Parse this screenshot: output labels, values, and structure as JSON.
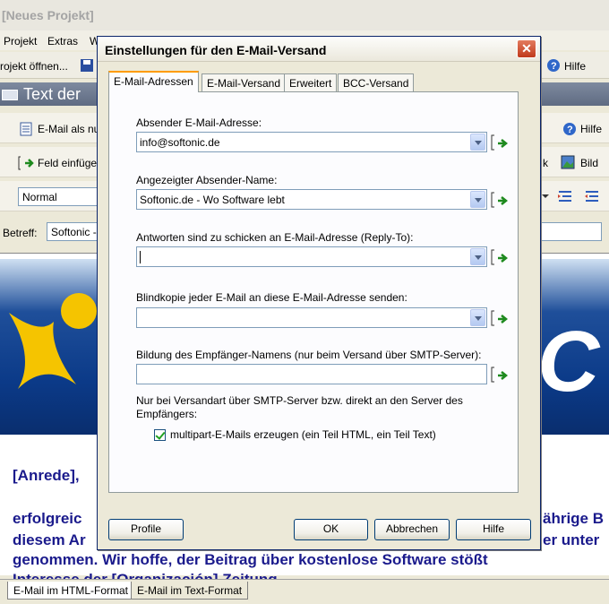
{
  "app": {
    "title": "[Neues Projekt]",
    "menu": [
      "Projekt",
      "Extras",
      "W"
    ],
    "toolbar1": {
      "open_label": "rojekt öffnen...",
      "help_label": "Hilfe"
    },
    "section_title": "Text der",
    "toolbar2": {
      "email_label": "E-Mail als nu",
      "help_label": "Hilfe"
    },
    "toolbar3": {
      "field_label": "Feld einfüge",
      "right_label": "k",
      "image_label": "Bild"
    },
    "toolbar4": {
      "style_value": "Normal"
    },
    "subject": {
      "label": "Betreff:",
      "value": "Softonic -"
    },
    "body_lines": [
      "[Anrede],",
      "erfolgreic",
      "diesem Ar",
      "genommen. Wir hoffe, der Beitrag über kostenlose Software stößt",
      "Interesse der [Organización] Zeitung."
    ],
    "body_right": [
      "ährige B",
      "er unter"
    ],
    "bottom_tabs": [
      "E-Mail im HTML-Format",
      "E-Mail im Text-Format"
    ]
  },
  "dialog": {
    "title": "Einstellungen für den E-Mail-Versand",
    "close_glyph": "✕",
    "tabs": [
      "E-Mail-Adressen",
      "E-Mail-Versand",
      "Erweitert",
      "BCC-Versand"
    ],
    "fields": {
      "sender_email": {
        "label": "Absender E-Mail-Adresse:",
        "value": "info@softonic.de"
      },
      "sender_name": {
        "label": "Angezeigter Absender-Name:",
        "value": "Softonic.de  - Wo Software lebt"
      },
      "reply_to": {
        "label": "Antworten sind zu schicken an E-Mail-Adresse (Reply-To):",
        "value": ""
      },
      "bcc": {
        "label": "Blindkopie jeder E-Mail an diese E-Mail-Adresse senden:",
        "value": ""
      },
      "recipient_name": {
        "label": "Bildung des Empfänger-Namens (nur beim Versand über SMTP-Server):",
        "value": ""
      }
    },
    "note": "Nur bei Versandart über SMTP-Server bzw. direkt an den Server des Empfängers:",
    "multipart_label": "multipart-E-Mails erzeugen (ein Teil HTML, ein Teil Text)",
    "buttons": {
      "profile": "Profile",
      "ok": "OK",
      "cancel": "Abbrechen",
      "help": "Hilfe"
    }
  },
  "colors": {
    "accent": "#ff9c00",
    "close": "#c0391b",
    "body_text": "#1a1a8c"
  },
  "icons": {
    "insert_field": "insert-field-icon",
    "help": "help-icon",
    "save": "save-icon"
  }
}
